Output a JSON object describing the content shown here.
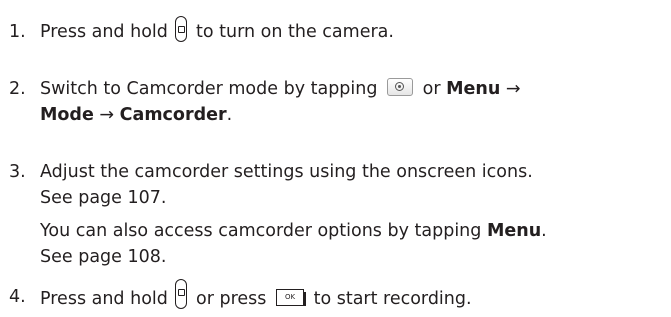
{
  "steps": [
    {
      "number": "1.",
      "pre": "Press and hold",
      "icon": "camera-key-icon",
      "post": "to turn on the camera."
    },
    {
      "number": "2.",
      "line1_pre": "Switch to Camcorder mode by tapping",
      "icon": "camera-mode-icon",
      "line1_mid": "or",
      "menu": "Menu",
      "arrow": "→",
      "mode": "Mode",
      "camcorder": "Camcorder",
      "period": "."
    },
    {
      "number": "3.",
      "line1": "Adjust the camcorder settings using the onscreen icons.",
      "line2": "See page 107.",
      "para2_line1_pre": "You can also access camcorder options by tapping",
      "para2_menu": "Menu",
      "para2_period": ".",
      "para2_line2": "See page 108."
    },
    {
      "number": "4.",
      "pre": "Press and hold",
      "icon1": "camera-key-icon",
      "mid": "or press",
      "icon2": "ok-key-icon",
      "ok_label": "OK",
      "post": "to start recording."
    }
  ]
}
